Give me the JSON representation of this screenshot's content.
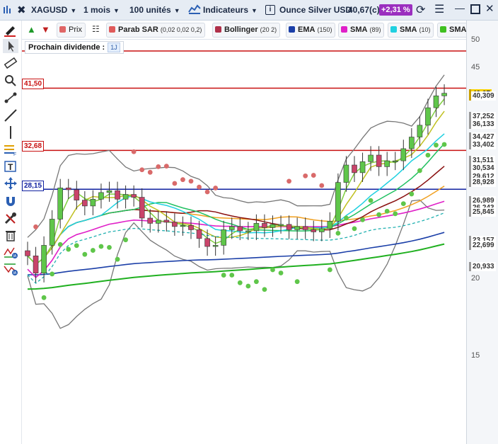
{
  "topbar": {
    "symbol": "XAGUSD",
    "period": "1 mois",
    "units": "100 unités",
    "indicators_label": "Indicateurs",
    "instrument": "Ounce Silver USD",
    "price": "40,67(c)",
    "change": "+2,31 %",
    "change_color": "#9b2fbf"
  },
  "indicator_bar": {
    "prix": "Prix",
    "items": [
      {
        "name": "Parab SAR",
        "params": "(0,02 0,02 0,2)",
        "color": "#e05a5a"
      },
      {
        "name": "Bollinger",
        "params": "(20 2)",
        "color": "#b0304a"
      },
      {
        "name": "EMA",
        "params": "(150)",
        "color": "#1b3fa8"
      },
      {
        "name": "SMA",
        "params": "(89)",
        "color": "#e020c8"
      },
      {
        "name": "SMA",
        "params": "(10)",
        "color": "#20d0e0"
      },
      {
        "name": "SMA",
        "params": "",
        "color": "#40c020"
      }
    ]
  },
  "dividend": {
    "label": "Prochain dividende :",
    "badge": "1J"
  },
  "levels": [
    {
      "value": "41,50",
      "color": "#c81010"
    },
    {
      "value": "32,68",
      "color": "#c81010"
    },
    {
      "value": "28,15",
      "color": "#1020a0"
    }
  ],
  "axis": {
    "ticks": [
      "50",
      "45",
      "20",
      "15"
    ]
  },
  "price_labels": [
    {
      "value": "40,67",
      "bg": "#f5d000",
      "fg": "#111"
    },
    {
      "value": "40,309",
      "bg": "#ffffff",
      "fg": "#333"
    },
    {
      "value": "37,252",
      "bg": "#ffffff",
      "fg": "#333"
    },
    {
      "value": "36,133",
      "bg": "#ffffff",
      "fg": "#333"
    },
    {
      "value": "34,427",
      "bg": "#ffffff",
      "fg": "#333"
    },
    {
      "value": "33,402",
      "bg": "#ffffff",
      "fg": "#333"
    },
    {
      "value": "31,511",
      "bg": "#ffffff",
      "fg": "#333"
    },
    {
      "value": "30,534",
      "bg": "#ffffff",
      "fg": "#333"
    },
    {
      "value": "29,612",
      "bg": "#ffffff",
      "fg": "#333"
    },
    {
      "value": "28,928",
      "bg": "#ffffff",
      "fg": "#333"
    },
    {
      "value": "26,989",
      "bg": "#ffffff",
      "fg": "#333"
    },
    {
      "value": "26,243",
      "bg": "#ffffff",
      "fg": "#333"
    },
    {
      "value": "25,845",
      "bg": "#ffffff",
      "fg": "#333"
    },
    {
      "value": "23,157",
      "bg": "#ffffff",
      "fg": "#333"
    },
    {
      "value": "22,742",
      "bg": "#ffffff",
      "fg": "#333"
    },
    {
      "value": "22,699",
      "bg": "#ffffff",
      "fg": "#333"
    },
    {
      "value": "20,933",
      "bg": "#ffffff",
      "fg": "#333"
    }
  ],
  "chart_data": {
    "type": "line",
    "series": [
      {
        "name": "Prix",
        "values": [
          21.8,
          20.4,
          22.7,
          25.1,
          28.3,
          28.1,
          27.0,
          26.4,
          27.1,
          27.8,
          28.0,
          27.1,
          27.6,
          27.3,
          25.2,
          24.7,
          25.0,
          24.8,
          24.4,
          24.5,
          24.1,
          23.3,
          22.6,
          22.7,
          24.1,
          24.4,
          24.0,
          24.0,
          24.7,
          24.3,
          24.6,
          24.6,
          24.1,
          24.4,
          24.1,
          23.9,
          24.2,
          24.9,
          28.9,
          30.9,
          30.0,
          31.3,
          32.1,
          30.7,
          31.4,
          31.4,
          32.9,
          34.4,
          36.0,
          38.5,
          40.3,
          40.7
        ]
      }
    ]
  }
}
